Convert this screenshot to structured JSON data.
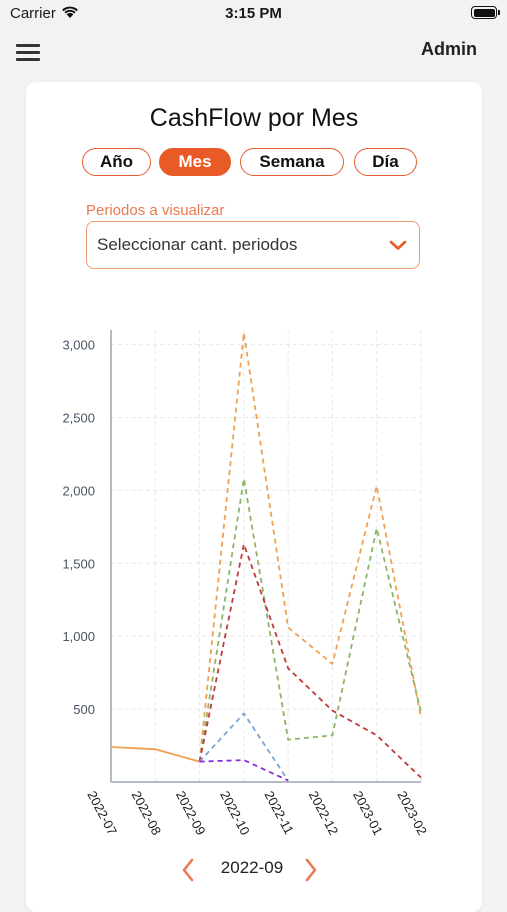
{
  "status_bar": {
    "carrier": "Carrier",
    "time": "3:15 PM"
  },
  "nav": {
    "user": "Admin"
  },
  "card": {
    "title": "CashFlow por Mes",
    "tabs": [
      {
        "label": "Año",
        "active": false
      },
      {
        "label": "Mes",
        "active": true
      },
      {
        "label": "Semana",
        "active": false
      },
      {
        "label": "Día",
        "active": false
      }
    ],
    "periods_label": "Periodos a visualizar",
    "periods_placeholder": "Seleccionar cant. periodos"
  },
  "pager": {
    "current": "2022-09"
  },
  "colors": {
    "accent": "#e85a26",
    "accent_light": "#ef9975"
  },
  "chart_data": {
    "type": "line",
    "title": "",
    "xlabel": "",
    "ylabel": "",
    "categories": [
      "2022-07",
      "2022-08",
      "2022-09",
      "2022-10",
      "2022-11",
      "2022-12",
      "2023-01",
      "2023-02"
    ],
    "ylim": [
      0,
      3100
    ],
    "yticks": [
      500,
      1000,
      1500,
      2000,
      2500,
      3000
    ],
    "ytick_labels": [
      "500",
      "1,000",
      "1,500",
      "2,000",
      "2,500",
      "3,000"
    ],
    "grid": true,
    "legend": "none",
    "series": [
      {
        "color": "#f0a150",
        "dash": false,
        "values": [
          240,
          225,
          140,
          null,
          null,
          null,
          null,
          null
        ]
      },
      {
        "color": "#f0a150",
        "dash": true,
        "values": [
          null,
          null,
          140,
          3080,
          1060,
          810,
          2030,
          440
        ]
      },
      {
        "color": "#8ab46a",
        "dash": true,
        "values": [
          null,
          null,
          140,
          2080,
          290,
          320,
          1740,
          480
        ]
      },
      {
        "color": "#c0393b",
        "dash": true,
        "values": [
          null,
          null,
          140,
          1630,
          780,
          490,
          320,
          30
        ]
      },
      {
        "color": "#7ba3d0",
        "dash": true,
        "values": [
          null,
          null,
          140,
          470,
          10,
          null,
          null,
          null
        ]
      },
      {
        "color": "#8a2be2",
        "dash": true,
        "values": [
          null,
          null,
          140,
          150,
          10,
          null,
          null,
          null
        ]
      }
    ]
  }
}
